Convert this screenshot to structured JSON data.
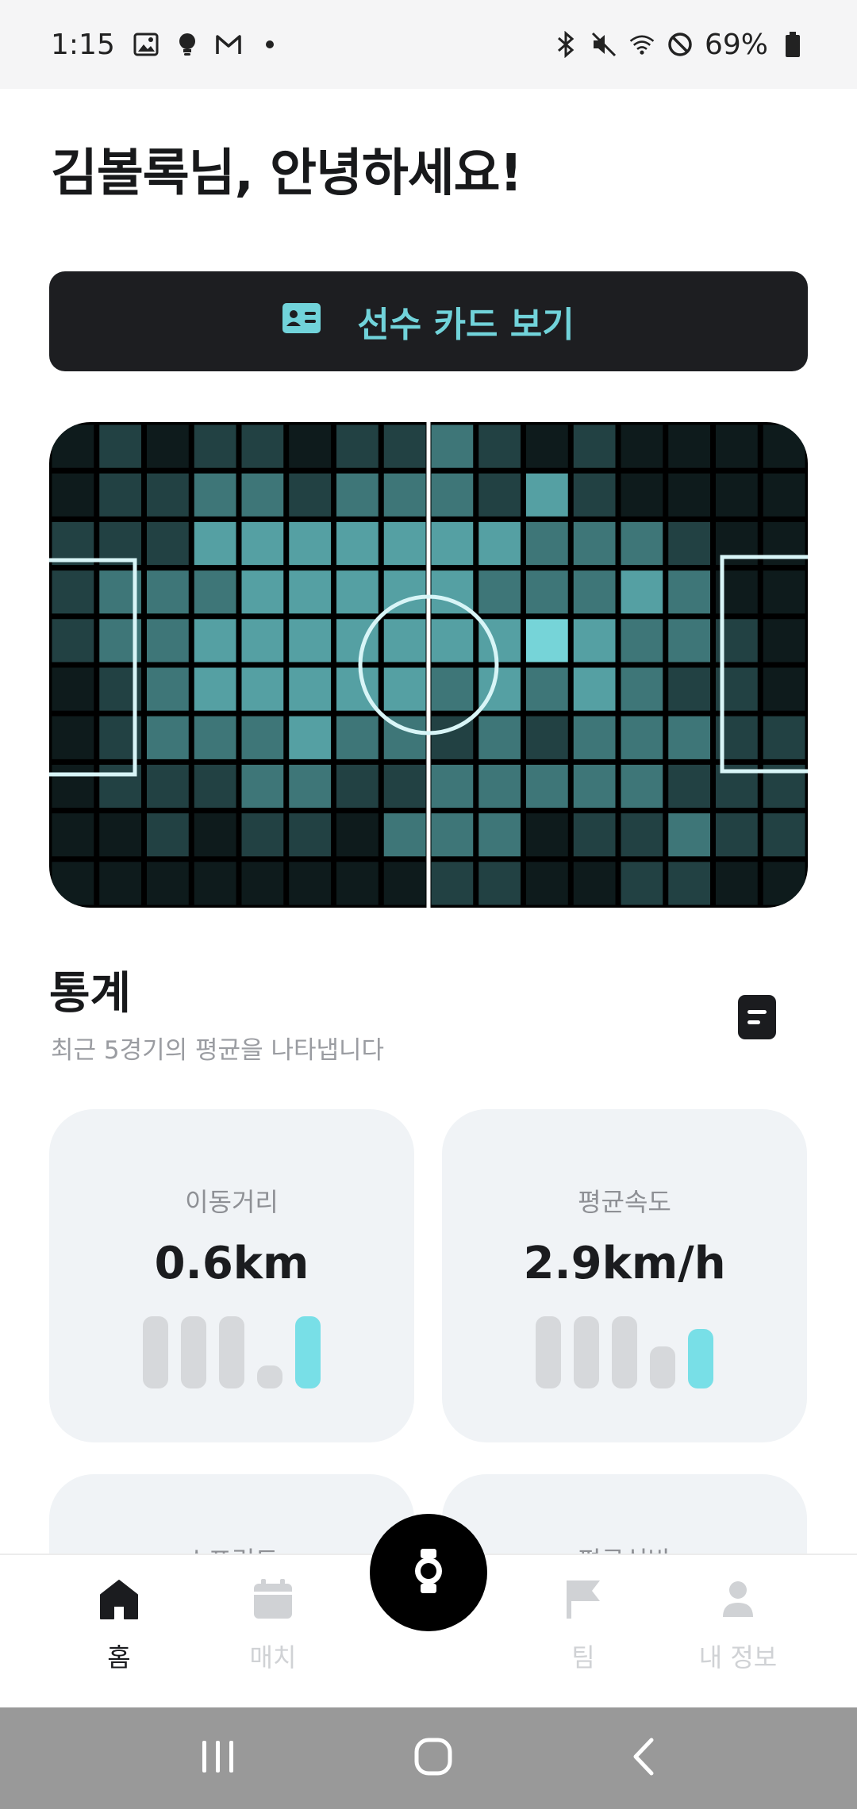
{
  "status_bar": {
    "time": "1:15",
    "battery": "69%",
    "left_icons": [
      "image-icon",
      "bulb-icon",
      "gmail-icon",
      "dot-icon"
    ],
    "right_icons": [
      "bluetooth-icon",
      "mute-icon",
      "wifi-icon",
      "dnd-icon",
      "battery-icon"
    ]
  },
  "greeting": "김볼록님, 안녕하세요!",
  "player_card_button": {
    "label": "선수 카드 보기",
    "icon": "id-card-icon",
    "color": "#71d3da"
  },
  "heatmap": {
    "rows": [
      [
        1,
        3,
        1,
        3,
        3,
        1,
        3,
        3,
        4,
        3,
        1,
        3,
        1,
        1,
        1,
        1
      ],
      [
        1,
        3,
        3,
        4,
        4,
        3,
        4,
        4,
        4,
        3,
        5,
        3,
        1,
        1,
        1,
        1
      ],
      [
        3,
        3,
        3,
        5,
        5,
        5,
        5,
        5,
        5,
        5,
        4,
        4,
        4,
        3,
        1,
        1
      ],
      [
        3,
        4,
        4,
        4,
        5,
        5,
        5,
        5,
        5,
        4,
        4,
        4,
        5,
        4,
        1,
        1
      ],
      [
        3,
        4,
        4,
        5,
        5,
        5,
        5,
        5,
        5,
        5,
        7,
        5,
        4,
        4,
        3,
        1
      ],
      [
        1,
        3,
        4,
        5,
        5,
        5,
        5,
        5,
        4,
        5,
        4,
        5,
        4,
        3,
        3,
        1
      ],
      [
        1,
        3,
        4,
        4,
        4,
        5,
        4,
        4,
        3,
        4,
        3,
        4,
        4,
        4,
        3,
        3
      ],
      [
        1,
        3,
        3,
        3,
        4,
        4,
        3,
        3,
        4,
        4,
        4,
        4,
        4,
        3,
        3,
        3
      ],
      [
        1,
        1,
        3,
        1,
        3,
        3,
        1,
        4,
        4,
        4,
        1,
        3,
        3,
        4,
        3,
        3
      ],
      [
        1,
        1,
        1,
        1,
        1,
        1,
        1,
        1,
        3,
        3,
        1,
        1,
        3,
        3,
        1,
        1
      ]
    ],
    "palette": [
      "#000000",
      "#0e1b1c",
      "#142527",
      "#224143",
      "#3e7678",
      "#55a0a3",
      "#5fb4b7",
      "#76d4d8"
    ],
    "line_color": "#d8f5f7"
  },
  "stats": {
    "title": "통계",
    "subtitle": "최근 5경기의 평균을 나타냅니다",
    "icon": "document-icon",
    "cards": [
      {
        "label": "이동거리",
        "value": "0.6km",
        "bars": [
          0.95,
          0.95,
          0.95,
          0.3,
          0.95
        ],
        "highlight_index": 4
      },
      {
        "label": "평균속도",
        "value": "2.9km/h",
        "bars": [
          0.95,
          0.95,
          0.95,
          0.55,
          0.78
        ],
        "highlight_index": 4
      },
      {
        "label": "스프린트"
      },
      {
        "label": "평균심박"
      }
    ]
  },
  "bottom_nav": {
    "items": [
      {
        "label": "홈",
        "icon": "home-icon",
        "active": true
      },
      {
        "label": "매치",
        "icon": "calendar-icon",
        "active": false
      },
      {
        "label": "팀",
        "icon": "flag-icon",
        "active": false
      },
      {
        "label": "내 정보",
        "icon": "person-icon",
        "active": false
      }
    ],
    "center_button": {
      "icon": "watch-icon"
    }
  },
  "system_nav": [
    "recents-icon",
    "home-circle-icon",
    "back-icon"
  ]
}
